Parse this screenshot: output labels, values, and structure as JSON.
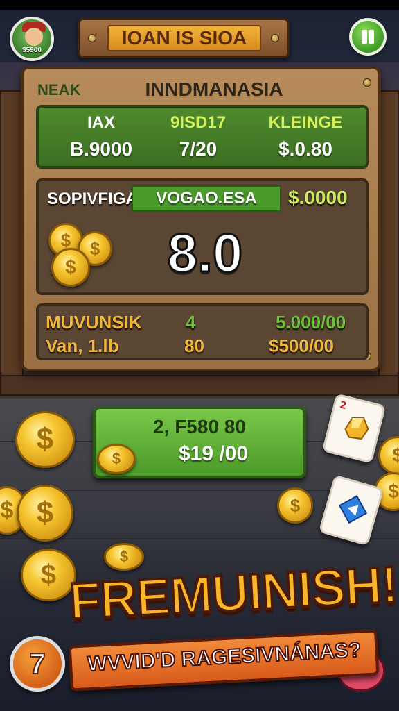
{
  "header": {
    "avatar_tag": "$5900",
    "title": "IOAN IS SIOA"
  },
  "board": {
    "label_left": "NEAK",
    "title": "INNDMANASIA",
    "stats": [
      {
        "header": "IAX",
        "value": "B.9000",
        "header_color": "#ffffff"
      },
      {
        "header": "9ISD17",
        "value": "7/20",
        "header_color": "#d7f25a"
      },
      {
        "header": "KLEINGE",
        "value": "$.0.80",
        "header_color": "#d7f25a"
      }
    ],
    "main_panel": {
      "left_label": "SOPIVFIGA",
      "bar_label": "VOGAO.ESA",
      "right_value": "$.0000",
      "big_value": "8.0"
    },
    "bottom_panel": {
      "row1": [
        "MUVUNSIK",
        "4",
        "5.000/00"
      ],
      "row2": [
        "Van, 1.lb",
        "80",
        "$500/00"
      ],
      "row1_colors": [
        "#f2b63a",
        "#6ec23a",
        "#6ec23a"
      ]
    }
  },
  "reward": {
    "line1": "2, F580 80",
    "line2": "$19 /00"
  },
  "coin_symbol": "$",
  "card_corner": "2",
  "banner": "FREMUINISH!",
  "ribbon_text": "WVVID'D RAGESIVNÁNAS?",
  "level": "7",
  "colors": {
    "wood": "#9a6f42",
    "green_panel": "#4f8a2e",
    "gold": "#f6c631",
    "banner": "#f8b52a"
  }
}
